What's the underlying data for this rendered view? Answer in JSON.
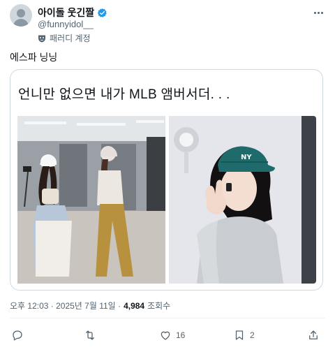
{
  "author": {
    "display_name": "아이돌 웃긴짤",
    "handle": "@funnyidol__",
    "parody_label": "패러디 계정",
    "verified_color": "#1d9bf0"
  },
  "tweet": {
    "text": "에스파 닝닝",
    "card_caption": "언니만 없으면 내가 MLB 앰버서더. . .",
    "timestamp": "오후 12:03 · 2025년 7월 11일 ·",
    "views_count": "4,984",
    "views_label": "조회수"
  },
  "actions": {
    "reply_count": "",
    "retweet_count": "",
    "like_count": "16",
    "bookmark_count": "2"
  },
  "icons": [
    "avatar",
    "verified-icon",
    "mask-icon",
    "more-icon",
    "reply-icon",
    "retweet-icon",
    "like-icon",
    "bookmark-icon",
    "share-icon"
  ]
}
